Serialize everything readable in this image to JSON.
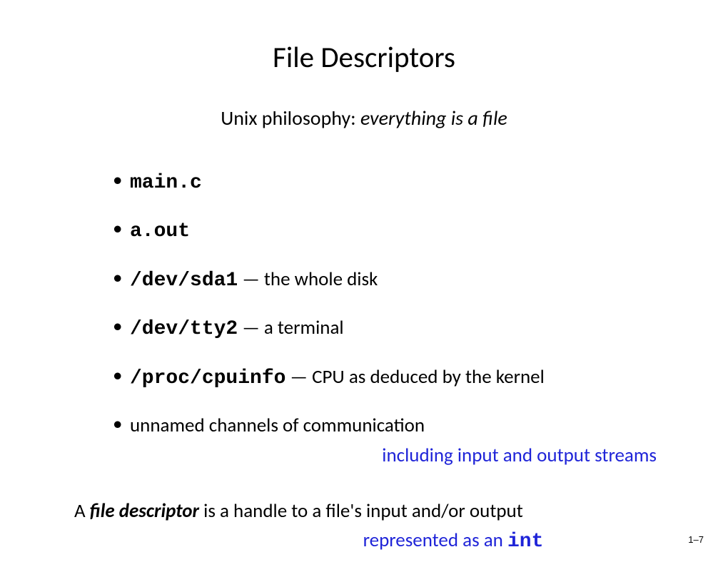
{
  "title": "File Descriptors",
  "subtitle": {
    "prefix": "Unix philosophy: ",
    "italic": "everything is a file"
  },
  "bullets": [
    {
      "code": "main.c",
      "rest": ""
    },
    {
      "code": "a.out",
      "rest": ""
    },
    {
      "code": "/dev/sda1",
      "rest": " — the whole disk"
    },
    {
      "code": "/dev/tty2",
      "rest": " — a terminal"
    },
    {
      "code": "/proc/cpuinfo",
      "rest": " — CPU as deduced by the kernel"
    },
    {
      "code": "",
      "rest": "unnamed channels of communication"
    }
  ],
  "subnote": "including input and output streams",
  "summary": {
    "pre": "A ",
    "term": "file descriptor",
    "post": " is a handle to a file's input and/or output"
  },
  "summary_sub": {
    "blue": "represented as an ",
    "code": "int"
  },
  "pagenum": "1–7"
}
